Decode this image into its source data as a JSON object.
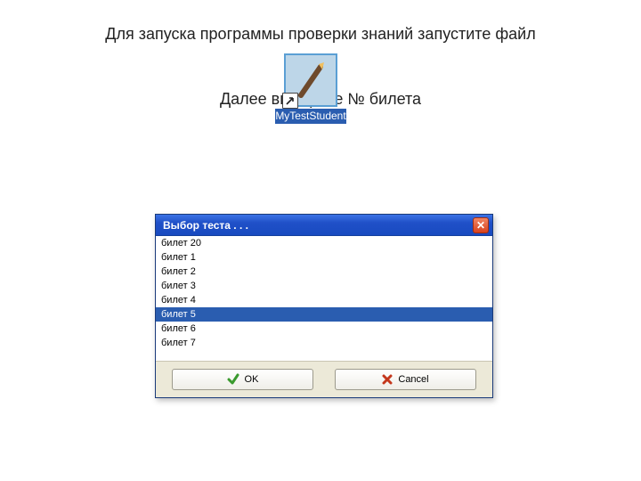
{
  "heading1": "Для запуска программы проверки знаний запустите файл",
  "shortcut": {
    "label": "MyTestStudent"
  },
  "heading2": "Далее выберите № билета",
  "dialog": {
    "title": "Выбор теста . . .",
    "items": [
      {
        "label": "билет 20",
        "selected": false
      },
      {
        "label": "билет 1",
        "selected": false
      },
      {
        "label": "билет 2",
        "selected": false
      },
      {
        "label": "билет 3",
        "selected": false
      },
      {
        "label": "билет 4",
        "selected": false
      },
      {
        "label": "билет 5",
        "selected": true
      },
      {
        "label": "билет 6",
        "selected": false
      },
      {
        "label": "билет 7",
        "selected": false
      }
    ],
    "ok_label": "OK",
    "cancel_label": "Cancel"
  }
}
